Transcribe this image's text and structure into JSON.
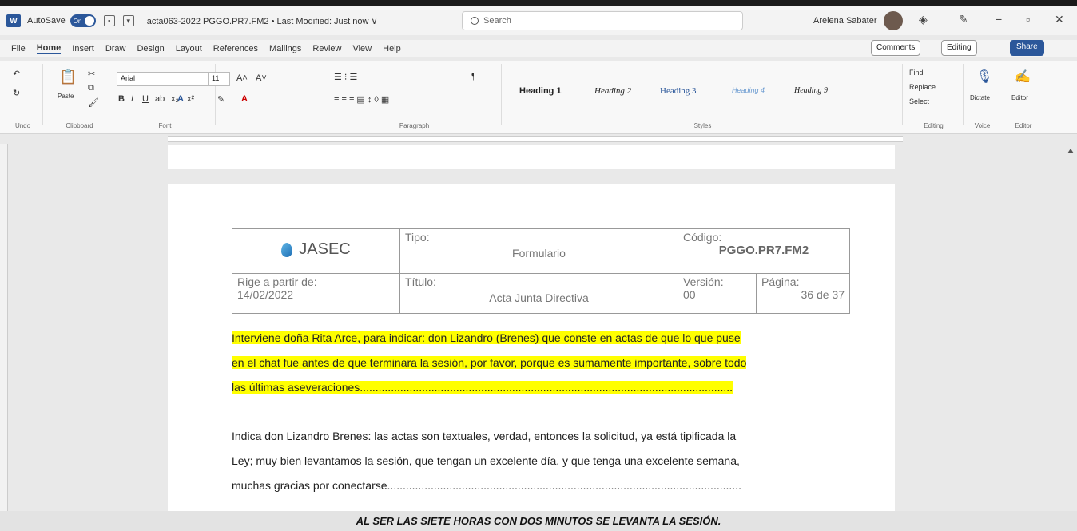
{
  "titlebar": {
    "autosave_label": "AutoSave",
    "autosave_state": "On",
    "document_title": "acta063-2022 PGGO.PR7.FM2 • Last Modified: Just now ∨",
    "search_placeholder": "Search",
    "user_name": "Arelena Sabater"
  },
  "menu": {
    "tabs": [
      "File",
      "Home",
      "Insert",
      "Draw",
      "Design",
      "Layout",
      "References",
      "Mailings",
      "Review",
      "View",
      "Help"
    ],
    "comments": "Comments",
    "editing": "Editing",
    "share": "Share"
  },
  "ribbon": {
    "undo": "Undo",
    "clipboard": "Clipboard",
    "paste": "Paste",
    "font_name": "Arial",
    "font_size": "11",
    "font": "Font",
    "paragraph": "Paragraph",
    "styles": "Styles",
    "style_items": [
      "Heading 1",
      "Heading 2",
      "Heading 3",
      "Heading 4",
      "Heading 9"
    ],
    "find": "Find",
    "replace": "Replace",
    "select": "Select",
    "editing_group": "Editing",
    "dictate": "Dictate",
    "voice": "Voice",
    "editor": "Editor",
    "editor_group": "Editor"
  },
  "doc_header": {
    "logo_text": "JASEC",
    "tipo_label": "Tipo:",
    "tipo_value": "Formulario",
    "codigo_label": "Código:",
    "codigo_value": "PGGO.PR7.FM2",
    "rige_label": "Rige a partir de:",
    "rige_value": "14/02/2022",
    "titulo_label": "Título:",
    "titulo_value": "Acta Junta Directiva",
    "version_label": "Versión:",
    "version_value": "00",
    "pagina_label": "Página:",
    "pagina_value": "36 de 37"
  },
  "body": {
    "para1_line1": "Interviene doña Rita Arce, para indicar: don Lizandro (Brenes) que conste en actas de que lo que puse",
    "para1_line2": "en el chat fue antes de que terminara la sesión, por favor, porque es sumamente importante, sobre todo",
    "para1_line3": "las últimas aseveraciones........................................................................................................................",
    "para2_line1": "Indica don Lizandro Brenes: las actas son textuales, verdad, entonces la solicitud, ya está tipificada la",
    "para2_line2": "Ley; muy bien levantamos la sesión, que tengan un excelente día, y que tenga una excelente semana,",
    "para2_line3": "muchas gracias por conectarse..................................................................................................................",
    "closing": "AL SER LAS SIETE HORAS CON DOS MINUTOS SE LEVANTA LA SESIÓN."
  }
}
